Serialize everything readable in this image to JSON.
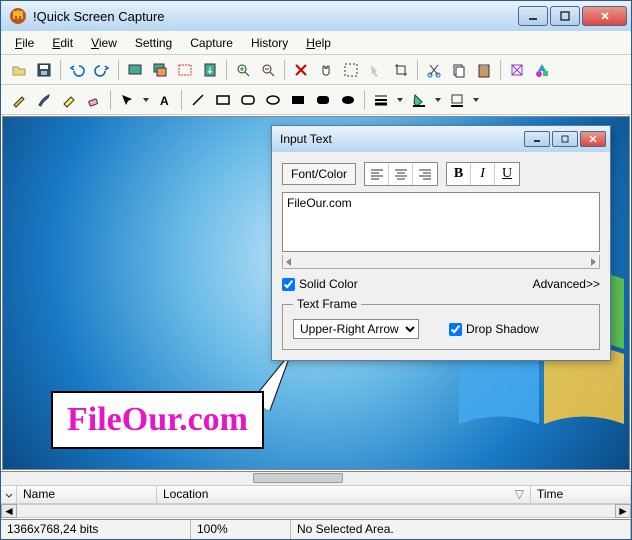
{
  "app": {
    "title": "!Quick Screen Capture"
  },
  "menu": {
    "file": "File",
    "edit": "Edit",
    "view": "View",
    "setting": "Setting",
    "capture": "Capture",
    "history": "History",
    "help": "Help"
  },
  "dialog": {
    "title": "Input Text",
    "font_color_btn": "Font/Color",
    "bold": "B",
    "italic": "I",
    "underline": "U",
    "text_value": "FileOur.com",
    "solid_color": "Solid Color",
    "advanced": "Advanced>>",
    "frame_legend": "Text Frame",
    "frame_value": "Upper-Right Arrow",
    "drop_shadow": "Drop Shadow"
  },
  "callout": {
    "text": "FileOur.com"
  },
  "list": {
    "name": "Name",
    "location": "Location",
    "time": "Time"
  },
  "status": {
    "dims": "1366x768,24 bits",
    "zoom": "100%",
    "sel": "No Selected Area."
  }
}
